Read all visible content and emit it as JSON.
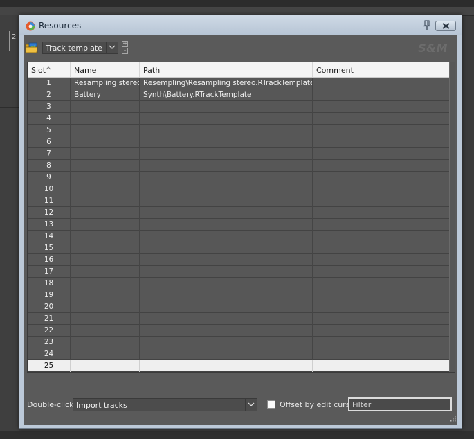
{
  "window": {
    "title": "Resources"
  },
  "toolbar": {
    "resource_type": "Track template",
    "logo": "S&M",
    "add_symbol": "+",
    "remove_symbol": "-"
  },
  "table": {
    "columns": [
      "Slot",
      "Name",
      "Path",
      "Comment"
    ],
    "rows": [
      {
        "slot": "1",
        "name": "Resampling stereo",
        "path": "Resempling\\Resampling stereo.RTrackTemplate",
        "comment": ""
      },
      {
        "slot": "2",
        "name": "Battery",
        "path": "Synth\\Battery.RTrackTemplate",
        "comment": ""
      },
      {
        "slot": "3",
        "name": "",
        "path": "",
        "comment": ""
      },
      {
        "slot": "4",
        "name": "",
        "path": "",
        "comment": ""
      },
      {
        "slot": "5",
        "name": "",
        "path": "",
        "comment": ""
      },
      {
        "slot": "6",
        "name": "",
        "path": "",
        "comment": ""
      },
      {
        "slot": "7",
        "name": "",
        "path": "",
        "comment": ""
      },
      {
        "slot": "8",
        "name": "",
        "path": "",
        "comment": ""
      },
      {
        "slot": "9",
        "name": "",
        "path": "",
        "comment": ""
      },
      {
        "slot": "10",
        "name": "",
        "path": "",
        "comment": ""
      },
      {
        "slot": "11",
        "name": "",
        "path": "",
        "comment": ""
      },
      {
        "slot": "12",
        "name": "",
        "path": "",
        "comment": ""
      },
      {
        "slot": "13",
        "name": "",
        "path": "",
        "comment": ""
      },
      {
        "slot": "14",
        "name": "",
        "path": "",
        "comment": ""
      },
      {
        "slot": "15",
        "name": "",
        "path": "",
        "comment": ""
      },
      {
        "slot": "16",
        "name": "",
        "path": "",
        "comment": ""
      },
      {
        "slot": "17",
        "name": "",
        "path": "",
        "comment": ""
      },
      {
        "slot": "18",
        "name": "",
        "path": "",
        "comment": ""
      },
      {
        "slot": "19",
        "name": "",
        "path": "",
        "comment": ""
      },
      {
        "slot": "20",
        "name": "",
        "path": "",
        "comment": ""
      },
      {
        "slot": "21",
        "name": "",
        "path": "",
        "comment": ""
      },
      {
        "slot": "22",
        "name": "",
        "path": "",
        "comment": ""
      },
      {
        "slot": "23",
        "name": "",
        "path": "",
        "comment": ""
      },
      {
        "slot": "24",
        "name": "",
        "path": "",
        "comment": ""
      },
      {
        "slot": "25",
        "name": "",
        "path": "",
        "comment": "",
        "selected": true
      }
    ]
  },
  "footer": {
    "double_click_label": "Double-click:",
    "double_click_value": "Import tracks",
    "offset_label": "Offset by edit cursor",
    "offset_checked": false,
    "filter_placeholder": "Filter"
  },
  "background": {
    "track_number": "2"
  },
  "icons": {
    "app": "reaper-logo-icon",
    "pin": "pin-icon",
    "close": "close-icon",
    "resource_type": "folder-image-icon",
    "dropdown": "chevron-down-icon",
    "sort": "sort-ascending-icon",
    "resize": "resize-grip-icon"
  },
  "colors": {
    "panel": "#5a5a5a",
    "titlebar": "#bcc9d8",
    "selected_row": "#efefef"
  }
}
